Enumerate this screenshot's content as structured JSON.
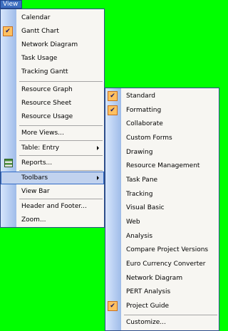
{
  "menubar": {
    "view_label": "View"
  },
  "view_menu": {
    "items": [
      {
        "label": "Calendar"
      },
      {
        "label": "Gantt Chart"
      },
      {
        "label": "Network Diagram"
      },
      {
        "label": "Task Usage"
      },
      {
        "label": "Tracking Gantt"
      },
      {
        "label": "Resource Graph"
      },
      {
        "label": "Resource Sheet"
      },
      {
        "label": "Resource Usage"
      },
      {
        "label": "More Views..."
      },
      {
        "label": "Table: Entry"
      },
      {
        "label": "Reports..."
      },
      {
        "label": "Toolbars"
      },
      {
        "label": "View Bar"
      },
      {
        "label": "Header and Footer..."
      },
      {
        "label": "Zoom..."
      }
    ]
  },
  "toolbars_menu": {
    "items": [
      {
        "label": "Standard"
      },
      {
        "label": "Formatting"
      },
      {
        "label": "Collaborate"
      },
      {
        "label": "Custom Forms"
      },
      {
        "label": "Drawing"
      },
      {
        "label": "Resource Management"
      },
      {
        "label": "Task Pane"
      },
      {
        "label": "Tracking"
      },
      {
        "label": "Visual Basic"
      },
      {
        "label": "Web"
      },
      {
        "label": "Analysis"
      },
      {
        "label": "Compare Project Versions"
      },
      {
        "label": "Euro Currency Converter"
      },
      {
        "label": "Network Diagram"
      },
      {
        "label": "PERT Analysis"
      },
      {
        "label": "Project Guide"
      },
      {
        "label": "Customize..."
      }
    ]
  },
  "colors": {
    "background": "#00ff00",
    "menu_bg": "#f7f6f2",
    "highlight": "#c1d2ee",
    "check_bg": "#ffc060"
  }
}
